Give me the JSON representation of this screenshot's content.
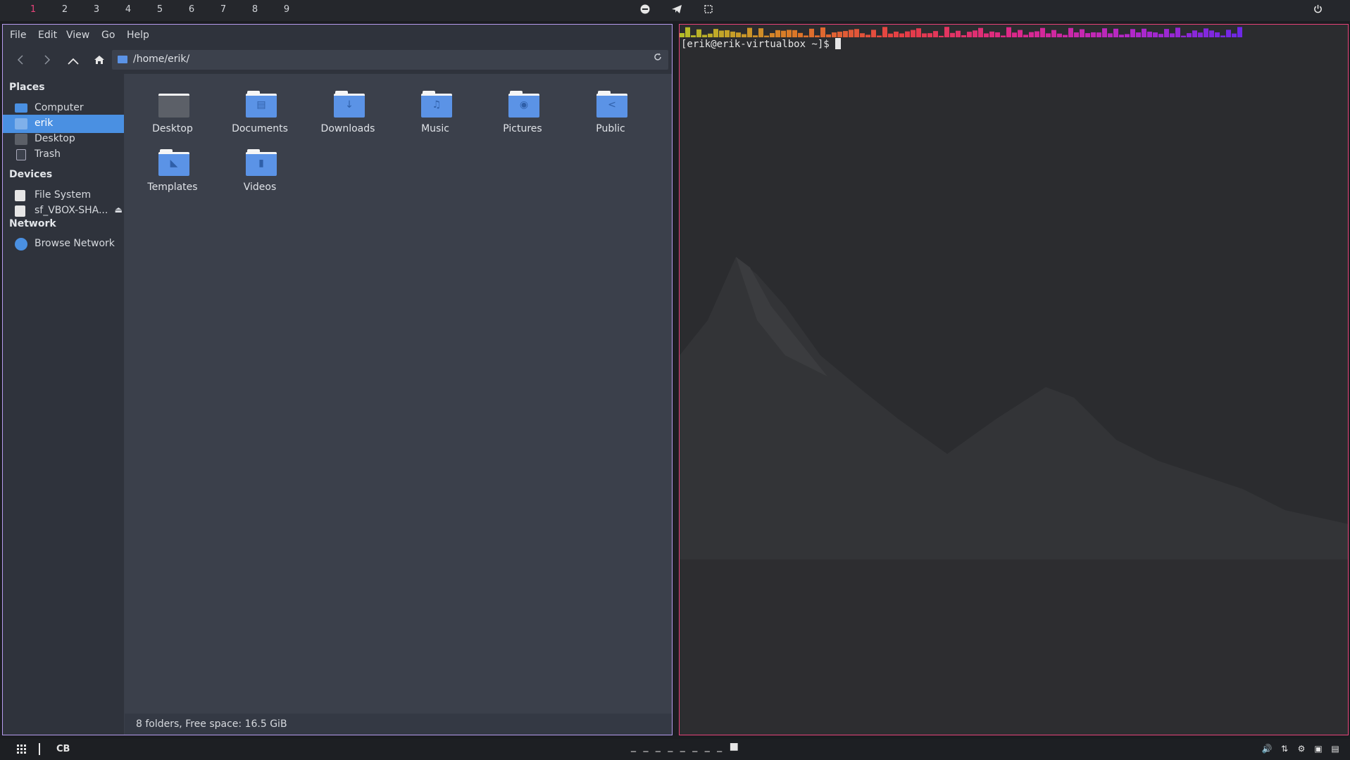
{
  "topbar": {
    "workspaces": [
      "1",
      "2",
      "3",
      "4",
      "5",
      "6",
      "7",
      "8",
      "9"
    ],
    "active_workspace": "1",
    "icons": {
      "center": [
        "pacman-icon",
        "telegram-icon",
        "screenshot-icon"
      ],
      "right": "power-icon"
    }
  },
  "file_manager": {
    "menu": [
      "File",
      "Edit",
      "View",
      "Go",
      "Help"
    ],
    "path": "/home/erik/",
    "sidebar": {
      "places_heading": "Places",
      "places": [
        {
          "label": "Computer",
          "icon": "computer-icon"
        },
        {
          "label": "erik",
          "icon": "home-folder-icon",
          "selected": true
        },
        {
          "label": "Desktop",
          "icon": "desktop-folder-icon"
        },
        {
          "label": "Trash",
          "icon": "trash-icon"
        }
      ],
      "devices_heading": "Devices",
      "devices": [
        {
          "label": "File System",
          "icon": "drive-icon"
        },
        {
          "label": "sf_VBOX-SHA...",
          "icon": "shared-drive-icon",
          "eject": true
        }
      ],
      "network_heading": "Network",
      "network": [
        {
          "label": "Browse Network",
          "icon": "network-globe-icon"
        }
      ]
    },
    "files": [
      {
        "label": "Desktop",
        "icon": "desktop-folder-icon"
      },
      {
        "label": "Documents",
        "icon": "documents-folder-icon"
      },
      {
        "label": "Downloads",
        "icon": "downloads-folder-icon"
      },
      {
        "label": "Music",
        "icon": "music-folder-icon"
      },
      {
        "label": "Pictures",
        "icon": "pictures-folder-icon"
      },
      {
        "label": "Public",
        "icon": "public-folder-icon"
      },
      {
        "label": "Templates",
        "icon": "templates-folder-icon"
      },
      {
        "label": "Videos",
        "icon": "videos-folder-icon"
      }
    ],
    "status": "8 folders, Free space: 16.5 GiB"
  },
  "terminal": {
    "prompt": "[erik@erik-virtualbox ~]$ "
  },
  "bottombar": {
    "layout_label": "CB",
    "dashes": "_ _ _ _ _ _ _ _ ■",
    "tray_icons": [
      "volume-icon",
      "network-arrows-icon",
      "settings-gear-icon",
      "display-icon",
      "clipboard-icon"
    ]
  },
  "colors": {
    "accent": "#e8437a",
    "selection": "#4a90e2",
    "folder": "#5b93e6",
    "fm_border": "#b79cf0"
  }
}
